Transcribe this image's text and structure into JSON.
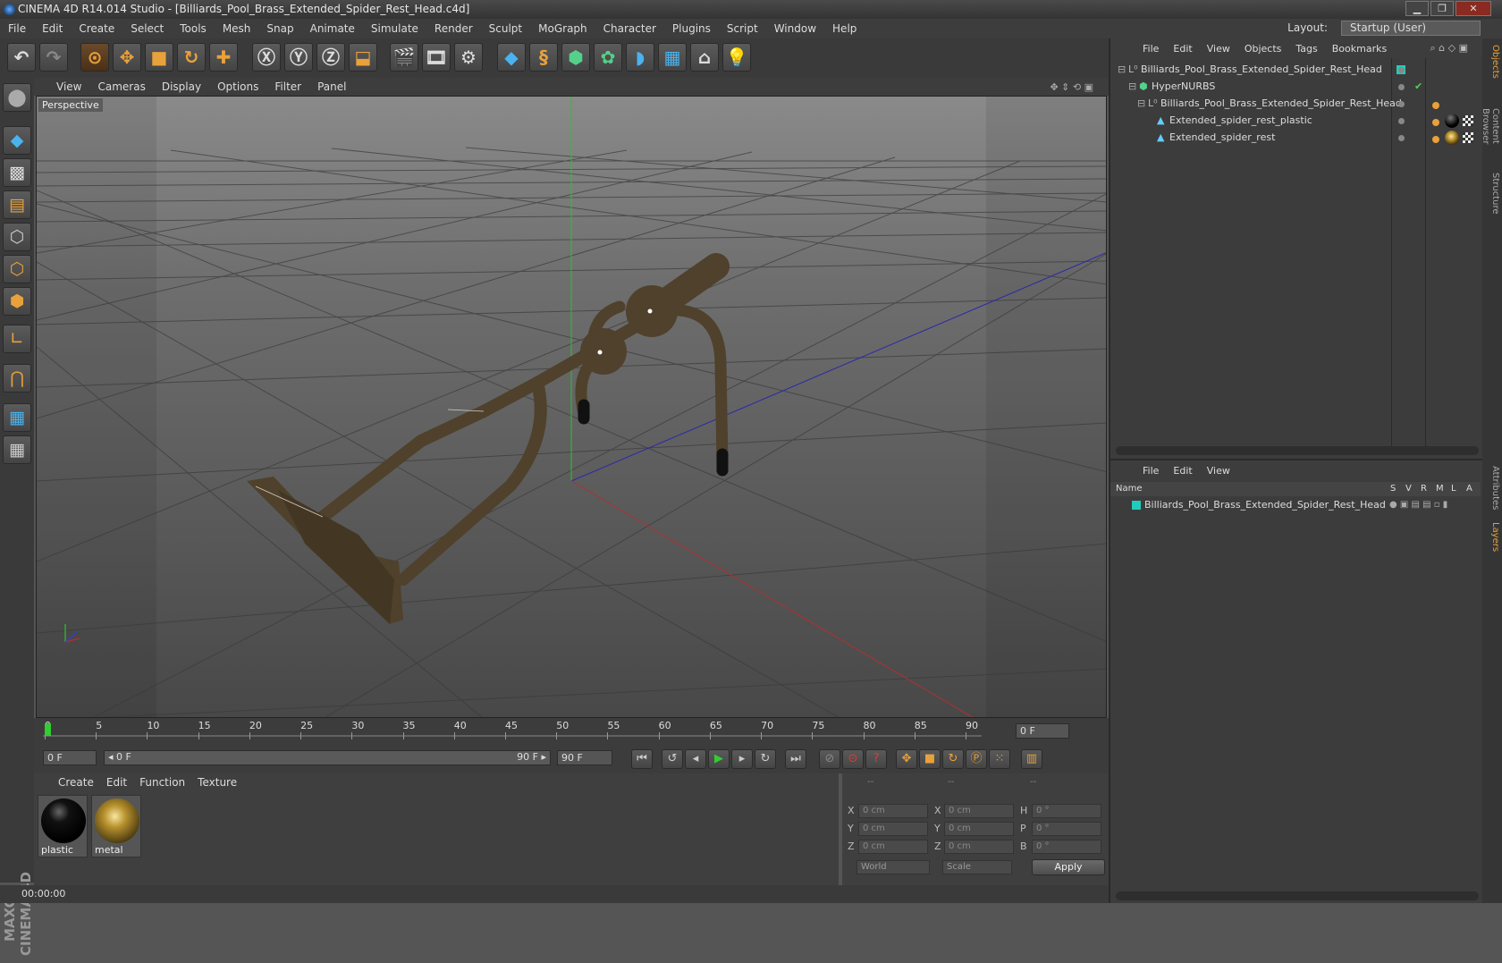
{
  "window": {
    "title": "CINEMA 4D R14.014 Studio - [Billiards_Pool_Brass_Extended_Spider_Rest_Head.c4d]",
    "min": "▁",
    "max": "❐",
    "close": "✕"
  },
  "menu": [
    "File",
    "Edit",
    "Create",
    "Select",
    "Tools",
    "Mesh",
    "Snap",
    "Animate",
    "Simulate",
    "Render",
    "Sculpt",
    "MoGraph",
    "Character",
    "Plugins",
    "Script",
    "Window",
    "Help"
  ],
  "layout": {
    "label": "Layout:",
    "value": "Startup (User)"
  },
  "viewport": {
    "menu": [
      "View",
      "Cameras",
      "Display",
      "Options",
      "Filter",
      "Panel"
    ],
    "label": "Perspective"
  },
  "timeline": {
    "ticks": [
      "0",
      "5",
      "10",
      "15",
      "20",
      "25",
      "30",
      "35",
      "40",
      "45",
      "50",
      "55",
      "60",
      "65",
      "70",
      "75",
      "80",
      "85",
      "90"
    ],
    "end_field": "0 F",
    "current": "0 F",
    "range_start": "◂ 0 F",
    "range_end": "90 F ▸",
    "max": "90 F"
  },
  "objects": {
    "menu": [
      "File",
      "Edit",
      "View",
      "Objects",
      "Tags",
      "Bookmarks"
    ],
    "rows": [
      {
        "label": "Billiards_Pool_Brass_Extended_Spider_Rest_Head",
        "indent": 0
      },
      {
        "label": "HyperNURBS",
        "indent": 1
      },
      {
        "label": "Billiards_Pool_Brass_Extended_Spider_Rest_Head",
        "indent": 2
      },
      {
        "label": "Extended_spider_rest_plastic",
        "indent": 3
      },
      {
        "label": "Extended_spider_rest",
        "indent": 3
      }
    ]
  },
  "layers": {
    "menu": [
      "File",
      "Edit",
      "View"
    ],
    "columns": [
      "Name",
      "S",
      "V",
      "R",
      "M",
      "L",
      "A"
    ],
    "rows": [
      "Billiards_Pool_Brass_Extended_Spider_Rest_Head"
    ]
  },
  "materials": {
    "menu": [
      "Create",
      "Edit",
      "Function",
      "Texture"
    ],
    "items": [
      {
        "name": "plastic",
        "color": "#0a0a0a"
      },
      {
        "name": "metal",
        "color": "#b8922e"
      }
    ]
  },
  "coords": {
    "headers": [
      "--",
      "--",
      "--"
    ],
    "rows": [
      {
        "a": "X",
        "av": "0 cm",
        "b": "X",
        "bv": "0 cm",
        "c": "H",
        "cv": "0 °"
      },
      {
        "a": "Y",
        "av": "0 cm",
        "b": "Y",
        "bv": "0 cm",
        "c": "P",
        "cv": "0 °"
      },
      {
        "a": "Z",
        "av": "0 cm",
        "b": "Z",
        "bv": "0 cm",
        "c": "B",
        "cv": "0 °"
      }
    ],
    "world": "World",
    "scale": "Scale",
    "apply": "Apply"
  },
  "status": {
    "time": "00:00:00"
  },
  "side_tabs": [
    "Objects",
    "Content Browser",
    "Structure",
    "Attributes",
    "Layers"
  ],
  "brand": "MAXON CINEMA 4D",
  "colors": {
    "accent": "#e8a13b",
    "object": "#5a4a32"
  }
}
